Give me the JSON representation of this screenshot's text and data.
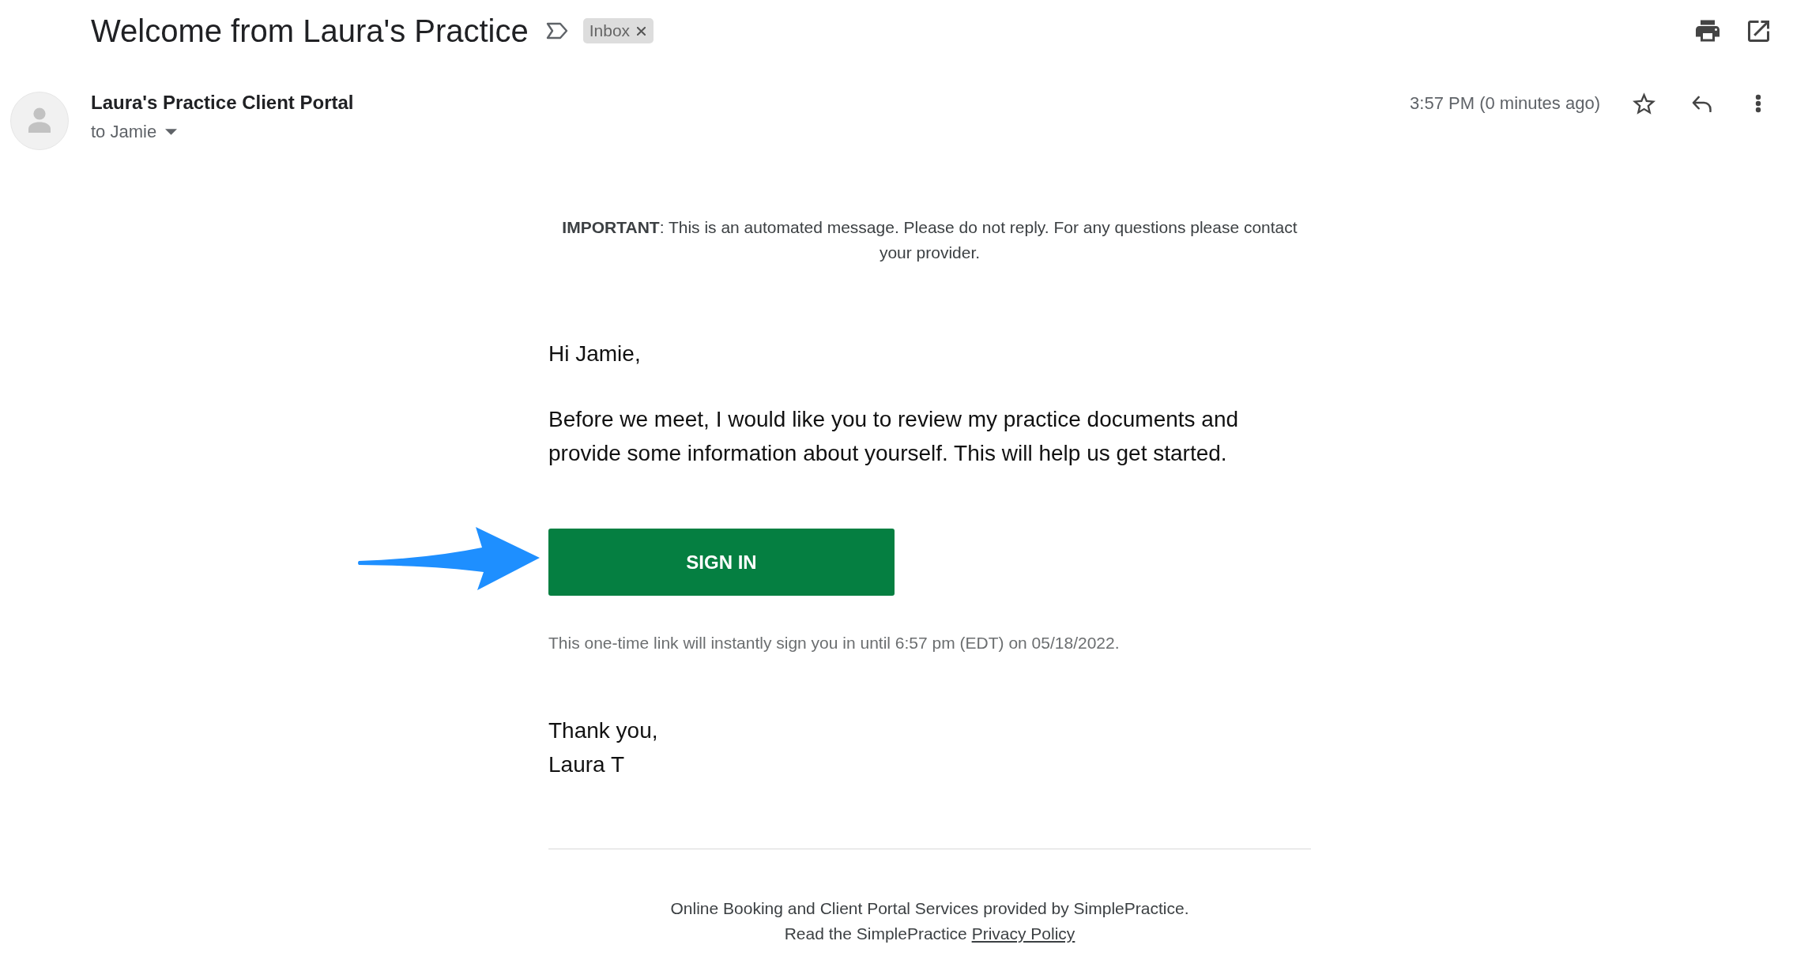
{
  "message": {
    "subject": "Welcome from Laura's Practice",
    "labels": [
      {
        "name": "Inbox"
      }
    ],
    "sender": "Laura's Practice Client Portal",
    "recipient": "to Jamie",
    "timestamp": "3:57 PM (0 minutes ago)",
    "starred": false
  },
  "body": {
    "notice": "**IMPORTANT**: This is an automated message. Please do not reply. For any questions please contact your provider.",
    "greeting": "Hi Jamie,",
    "paragraph": "Before we meet, I would like you to review my practice documents and provide some information about yourself. This will help us get started.",
    "button": "SIGN IN",
    "link_note": "This one-time link will instantly sign you in until 6:57 pm (EDT) on 05/18/2022.",
    "closing": "Thank you,",
    "signature": "Laura T"
  },
  "footer": {
    "provider_line": "Online Booking and Client Portal Services provided by SimplePractice.",
    "policy_line": "Read the SimplePractice",
    "policy_link": "Privacy Policy"
  }
}
